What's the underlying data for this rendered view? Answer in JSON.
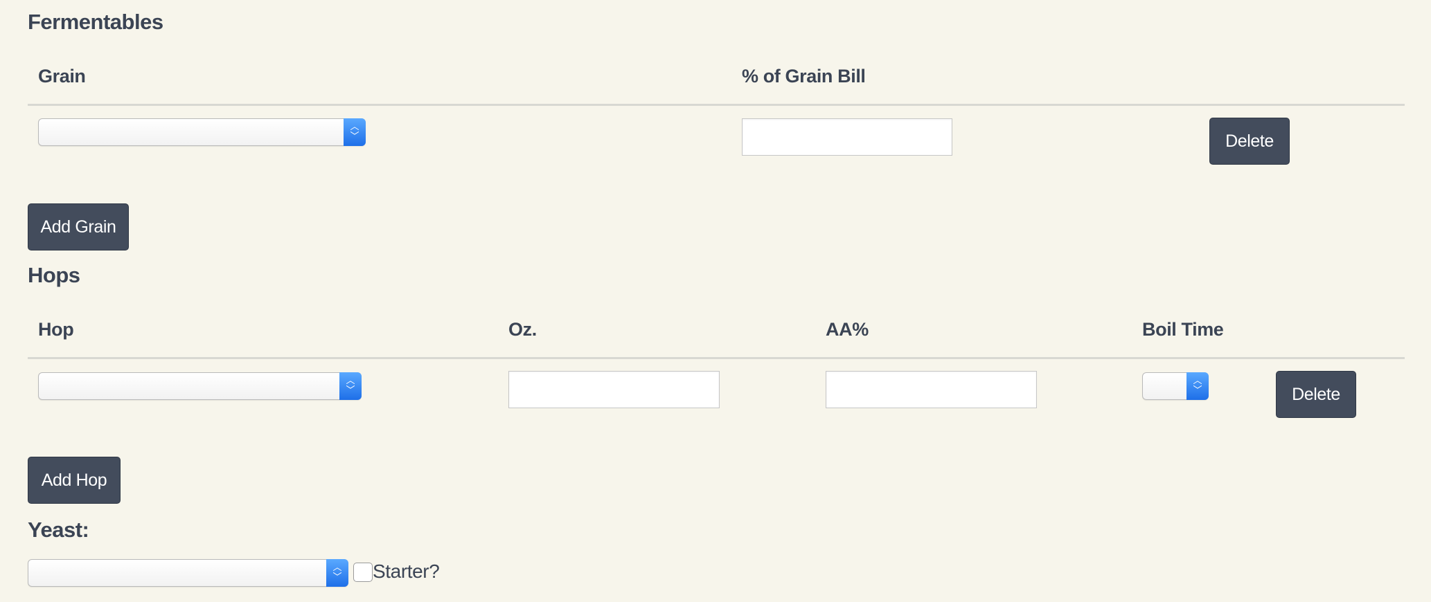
{
  "fermentables": {
    "heading": "Fermentables",
    "columns": {
      "grain": "Grain",
      "percent": "% of Grain Bill"
    },
    "row": {
      "grain_value": "",
      "percent_value": "",
      "delete_label": "Delete"
    },
    "add_label": "Add Grain"
  },
  "hops": {
    "heading": "Hops",
    "columns": {
      "hop": "Hop",
      "oz": "Oz.",
      "aa": "AA%",
      "boil_time": "Boil Time"
    },
    "row": {
      "hop_value": "",
      "oz_value": "",
      "aa_value": "",
      "boil_time_value": "",
      "delete_label": "Delete"
    },
    "add_label": "Add Hop"
  },
  "yeast": {
    "heading": "Yeast:",
    "value": "",
    "starter_label": "Starter?",
    "starter_checked": false
  },
  "icons": {
    "select_arrow": "chevron-up-down-icon"
  },
  "colors": {
    "background": "#f7f5eb",
    "text": "#3b4454",
    "button": "#434c5c",
    "select_accent": "#2f86f5"
  }
}
